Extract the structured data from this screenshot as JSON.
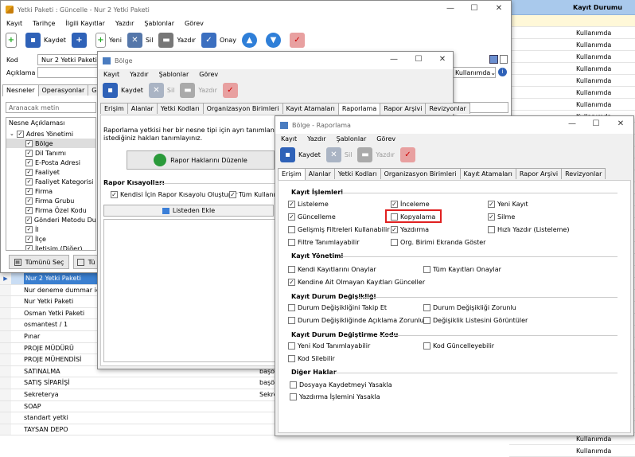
{
  "grid_right": {
    "header": "Kayıt Durumu",
    "rows": [
      "",
      "Kullanımda",
      "Kullanımda",
      "Kullanımda",
      "Kullanımda",
      "Kullanımda",
      "Kullanımda",
      "Kullanımda",
      "Kullanımda",
      "Kullanımda",
      "Kullanımda",
      "Kullanımda",
      "Kullanımda",
      "Kullanımda",
      "Kullanımda",
      "Kullanımda",
      "Kullanımda",
      "Kullanımda",
      "Kullanımda",
      "Kullanımda",
      "Kullanımda",
      "Kullanımda",
      "Kullanımda",
      "Kullanımda",
      "Kullanımda",
      "Kullanımda",
      "Kullanımda",
      "Kullanımda",
      "Kullanımda",
      "Kullanımda",
      "Kullanımda",
      "Kullanımda",
      "Kullanımda",
      "Kullanımda",
      "Kullanımda",
      "Kullanımda",
      "Kullanımda"
    ]
  },
  "grid_left": {
    "rows": [
      "Nur 2 Yetki Paketi",
      "Nur deneme dummar için",
      "Nur Yetki Paketi",
      "Osman Yetki Paketi",
      "osmantest / 1",
      "Pınar",
      "PROJE MÜDÜRÜ",
      "PROJE MÜHENDİSİ",
      "SATINALMA",
      "SATIŞ SİPARİŞİ",
      "Sekreterya",
      "SOAP",
      "standart yetki",
      "TAYSAN DEPO"
    ],
    "mid": [
      "",
      "",
      "",
      "",
      "",
      "",
      "",
      "",
      "başö",
      "başö",
      "Sekre",
      "",
      "",
      ""
    ]
  },
  "win1": {
    "title": "Yetki Paketi : Güncelle - Nur 2 Yetki Paketi",
    "menu": [
      "Kayıt",
      "Tarihçe",
      "İlgili Kayıtlar",
      "Yazdır",
      "Şablonlar",
      "Görev"
    ],
    "toolbar": {
      "save": "Kaydet",
      "new": "Yeni",
      "delete": "Sil",
      "print": "Yazdır",
      "approve": "Onay"
    },
    "kod_label": "Kod",
    "kod_value": "Nur 2 Yetki Paketi",
    "aciklama_label": "Açıklama",
    "status_combo": "Kullanımda",
    "tabs": [
      "Nesneler",
      "Operasyonlar",
      "Genel Y"
    ],
    "search_placeholder": "Aranacak metin",
    "tree_header": "Nesne Açıklaması",
    "tree": [
      "Adres Yönetimi",
      "Bölge",
      "Dil Tanımı",
      "E-Posta Adresi",
      "Faaliyet",
      "Faaliyet Kategorisi",
      "Firma",
      "Firma Grubu",
      "Firma Özel Kodu",
      "Gönderi Metodu Duru",
      "İl",
      "İlçe",
      "İletişim (Diğer)"
    ],
    "select_all": "Tümünü Seç",
    "select_btn2": "Tü"
  },
  "win2": {
    "title": "Bölge",
    "menu": [
      "Kayıt",
      "Yazdır",
      "Şablonlar",
      "Görev"
    ],
    "toolbar": {
      "save": "Kaydet",
      "delete": "Sil",
      "print": "Yazdır"
    },
    "tabs": [
      "Erişim",
      "Alanlar",
      "Yetki Kodları",
      "Organizasyon Birimleri",
      "Kayıt Atamaları",
      "Raporlama",
      "Rapor Arşivi",
      "Revizyonlar"
    ],
    "info": "Raporlama yetkisi her bir nesne tipi için ayrı tanımlanır. Aşağ",
    "info2": "istediğiniz hakları tanımlayınız.",
    "edit_btn": "Rapor Haklarını Düzenle",
    "shortcuts_label": "Rapor Kısayolları",
    "cb1": "Kendisi İçin Rapor Kısayolu Oluşturur",
    "cb2": "Tüm Kullanıc",
    "list_add": "Listeden Ekle"
  },
  "win3": {
    "title": "Bölge - Raporlama",
    "menu": [
      "Kayıt",
      "Yazdır",
      "Şablonlar",
      "Görev"
    ],
    "toolbar": {
      "save": "Kaydet",
      "delete": "Sil",
      "print": "Yazdır"
    },
    "tabs": [
      "Erişim",
      "Alanlar",
      "Yetki Kodları",
      "Organizasyon Birimleri",
      "Kayıt Atamaları",
      "Rapor Arşivi",
      "Revizyonlar"
    ],
    "sec1": "Kayıt İşlemleri",
    "sec2": "Kayıt Yönetimi",
    "sec3": "Kayıt Durum Değişikliği",
    "sec4": "Kayıt Durum Değiştirme Kodu",
    "sec5": "Diğer Haklar",
    "cbs": {
      "listeleme": "Listeleme",
      "inceleme": "İnceleme",
      "yeni_kayit": "Yeni Kayıt",
      "guncelleme": "Güncelleme",
      "kopyalama": "Kopyalama",
      "silme": "Silme",
      "gelismis": "Gelişmiş Filtreleri Kullanabilir",
      "yazdirma": "Yazdırma",
      "hizli": "Hızlı Yazdır (Listeleme)",
      "filtre": "Filtre Tanımlayabilir",
      "org": "Org. Birimi Ekranda Göster",
      "kendi_onay": "Kendi Kayıtlarını Onaylar",
      "tum_onay": "Tüm Kayıtları Onaylar",
      "kendine_ait": "Kendine Ait Olmayan Kayıtları Günceller",
      "durum_takip": "Durum Değişikliğini Takip Et",
      "durum_zorunlu": "Durum Değişikliği Zorunlu",
      "durum_aciklama": "Durum Değişikliğinde Açıklama Zorunlu",
      "degisiklik": "Değişiklik Listesini Görüntüler",
      "yeni_kod": "Yeni Kod Tanımlayabilir",
      "kod_guncel": "Kod Güncelleyebilir",
      "kod_sil": "Kod Silebilir",
      "dosya": "Dosyaya Kaydetmeyi Yasakla",
      "yazdirma_yasak": "Yazdırma İşlemini Yasakla"
    }
  },
  "colors": {
    "accent": "#3b7fd8",
    "highlight": "#e02020",
    "selected_row": "#c9ddf4"
  }
}
